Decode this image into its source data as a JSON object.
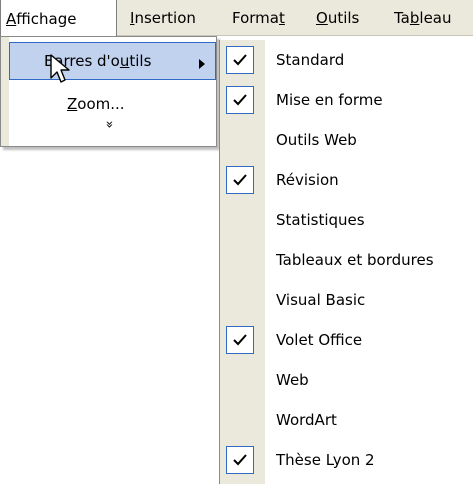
{
  "menubar": {
    "affichage_pre": "",
    "affichage_u": "A",
    "affichage_post": "ffichage",
    "insertion_pre": "",
    "insertion_u": "I",
    "insertion_post": "nsertion",
    "format_pre": "Forma",
    "format_u": "t",
    "format_post": "",
    "outils_pre": "",
    "outils_u": "O",
    "outils_post": "utils",
    "tableau_pre": "Ta",
    "tableau_u": "b",
    "tableau_post": "leau"
  },
  "affichage_menu": {
    "barres_pre": "Barres d'o",
    "barres_u": "u",
    "barres_post": "tils",
    "zoom_u": "Z",
    "zoom_post": "oom...",
    "expand_glyph": "»"
  },
  "toolbars_submenu": {
    "items": [
      {
        "label": "Standard",
        "checked": true
      },
      {
        "label": "Mise en forme",
        "checked": true
      },
      {
        "label": "Outils Web",
        "checked": false
      },
      {
        "label": "Révision",
        "checked": true
      },
      {
        "label": "Statistiques",
        "checked": false
      },
      {
        "label": "Tableaux et bordures",
        "checked": false
      },
      {
        "label": "Visual Basic",
        "checked": false
      },
      {
        "label": "Volet Office",
        "checked": true
      },
      {
        "label": "Web",
        "checked": false
      },
      {
        "label": "WordArt",
        "checked": false
      },
      {
        "label": "Thèse Lyon 2",
        "checked": true
      }
    ]
  },
  "colors": {
    "menu_bg": "#ebe8dc",
    "highlight_fill": "#c1d2ee",
    "highlight_border": "#316ac5"
  }
}
